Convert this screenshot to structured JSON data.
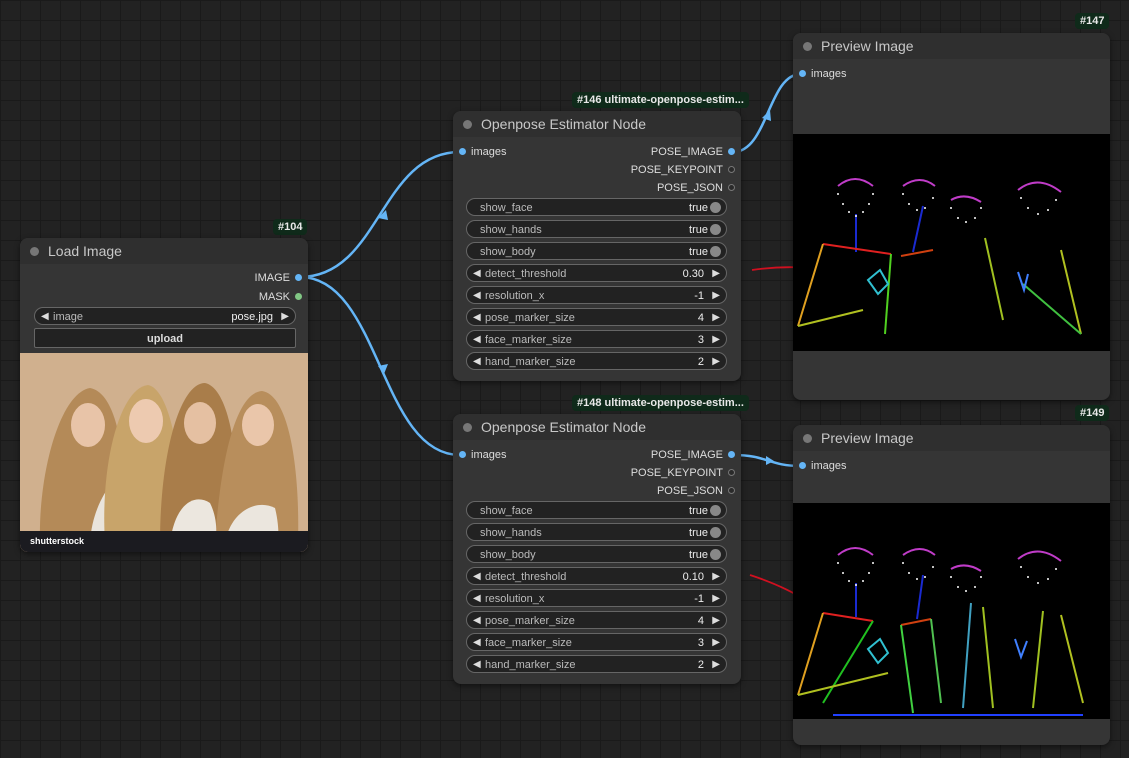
{
  "load_image": {
    "badge": "#104",
    "title": "Load Image",
    "outputs": [
      "IMAGE",
      "MASK"
    ],
    "image_label": "image",
    "image_value": "pose.jpg",
    "upload_label": "upload",
    "photo_caption": "shutterstock"
  },
  "estimators": [
    {
      "badge": "#146 ultimate-openpose-estim...",
      "title": "Openpose Estimator Node",
      "input": "images",
      "outputs": [
        "POSE_IMAGE",
        "POSE_KEYPOINT",
        "POSE_JSON"
      ],
      "toggles": [
        {
          "label": "show_face",
          "value": "true"
        },
        {
          "label": "show_hands",
          "value": "true"
        },
        {
          "label": "show_body",
          "value": "true"
        }
      ],
      "params": [
        {
          "label": "detect_threshold",
          "value": "0.30"
        },
        {
          "label": "resolution_x",
          "value": "-1"
        },
        {
          "label": "pose_marker_size",
          "value": "4"
        },
        {
          "label": "face_marker_size",
          "value": "3"
        },
        {
          "label": "hand_marker_size",
          "value": "2"
        }
      ]
    },
    {
      "badge": "#148 ultimate-openpose-estim...",
      "title": "Openpose Estimator Node",
      "input": "images",
      "outputs": [
        "POSE_IMAGE",
        "POSE_KEYPOINT",
        "POSE_JSON"
      ],
      "toggles": [
        {
          "label": "show_face",
          "value": "true"
        },
        {
          "label": "show_hands",
          "value": "true"
        },
        {
          "label": "show_body",
          "value": "true"
        }
      ],
      "params": [
        {
          "label": "detect_threshold",
          "value": "0.10"
        },
        {
          "label": "resolution_x",
          "value": "-1"
        },
        {
          "label": "pose_marker_size",
          "value": "4"
        },
        {
          "label": "face_marker_size",
          "value": "3"
        },
        {
          "label": "hand_marker_size",
          "value": "2"
        }
      ]
    }
  ],
  "previews": [
    {
      "badge": "#147",
      "title": "Preview Image",
      "input": "images"
    },
    {
      "badge": "#149",
      "title": "Preview Image",
      "input": "images"
    }
  ],
  "colors": {
    "wire": "#64b5f6",
    "annotation": "#d01020",
    "node_bg": "#353535",
    "canvas": "#222222"
  }
}
